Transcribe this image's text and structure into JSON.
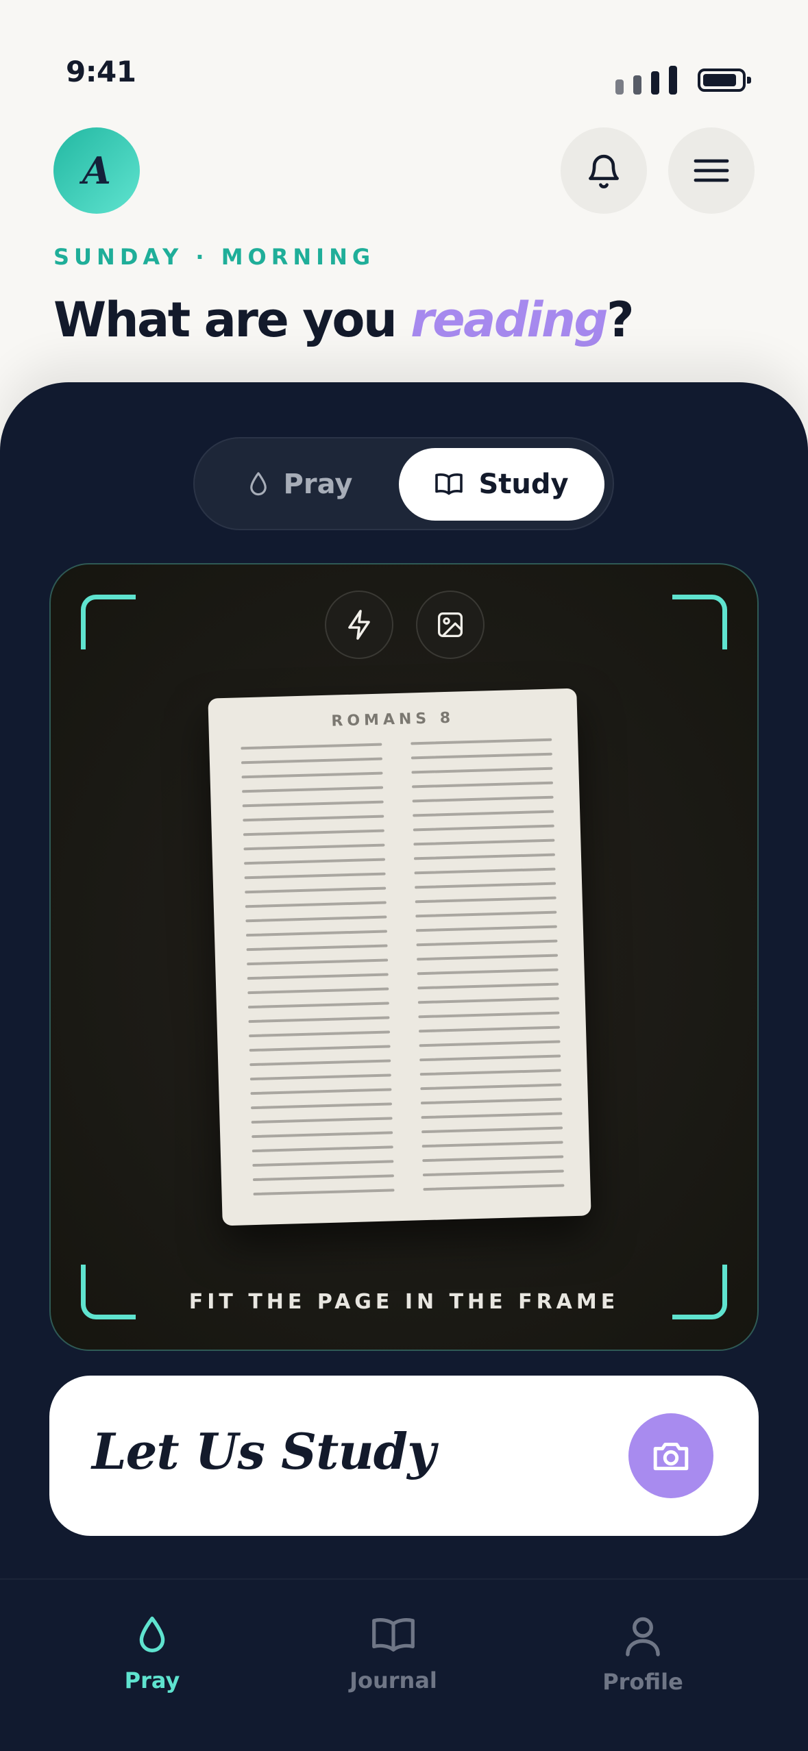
{
  "status_bar": {
    "time": "9:41"
  },
  "header": {
    "avatar_letter": "A",
    "eyebrow": "SUNDAY · MORNING",
    "headline_prefix": "What are you ",
    "headline_accent": "reading",
    "headline_suffix": "?"
  },
  "mode_toggle": {
    "options": [
      {
        "label": "Pray",
        "icon": "drop-icon",
        "selected": false
      },
      {
        "label": "Study",
        "icon": "open-book-icon",
        "selected": true
      }
    ]
  },
  "camera": {
    "tools": [
      "flash-icon",
      "gallery-image-icon"
    ],
    "page_title": "ROMANS 8",
    "hint": "FIT THE PAGE IN THE FRAME"
  },
  "cta": {
    "label": "Let Us Study",
    "button_icon": "camera-icon"
  },
  "tab_bar": {
    "items": [
      {
        "label": "Pray",
        "icon": "drop-icon",
        "active": true
      },
      {
        "label": "Journal",
        "icon": "open-book-icon",
        "active": false
      },
      {
        "label": "Profile",
        "icon": "person-icon",
        "active": false
      }
    ]
  },
  "colors": {
    "accent_teal": "#5fe3cf",
    "accent_purple": "#a88bef",
    "panel_dark": "#111a2f",
    "background": "#f8f7f4"
  }
}
